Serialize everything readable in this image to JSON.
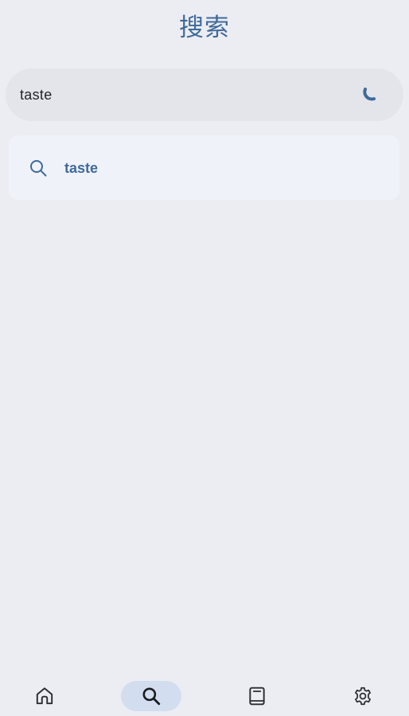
{
  "header": {
    "title": "搜索"
  },
  "search": {
    "value": "taste",
    "loading_icon": "loading-spinner-icon"
  },
  "results": [
    {
      "label": "taste",
      "icon": "search-icon"
    }
  ],
  "bottom_nav": {
    "items": [
      {
        "icon": "home-icon",
        "selected": false
      },
      {
        "icon": "search-icon",
        "selected": true
      },
      {
        "icon": "book-icon",
        "selected": false
      },
      {
        "icon": "gear-icon",
        "selected": false
      }
    ]
  },
  "colors": {
    "background": "#ecedf3",
    "accent": "#3f6a98",
    "search_bar": "#e3e5eb",
    "card": "#f0f2fa",
    "nav_selected": "#d2deef",
    "icon": "#2a2d33"
  }
}
